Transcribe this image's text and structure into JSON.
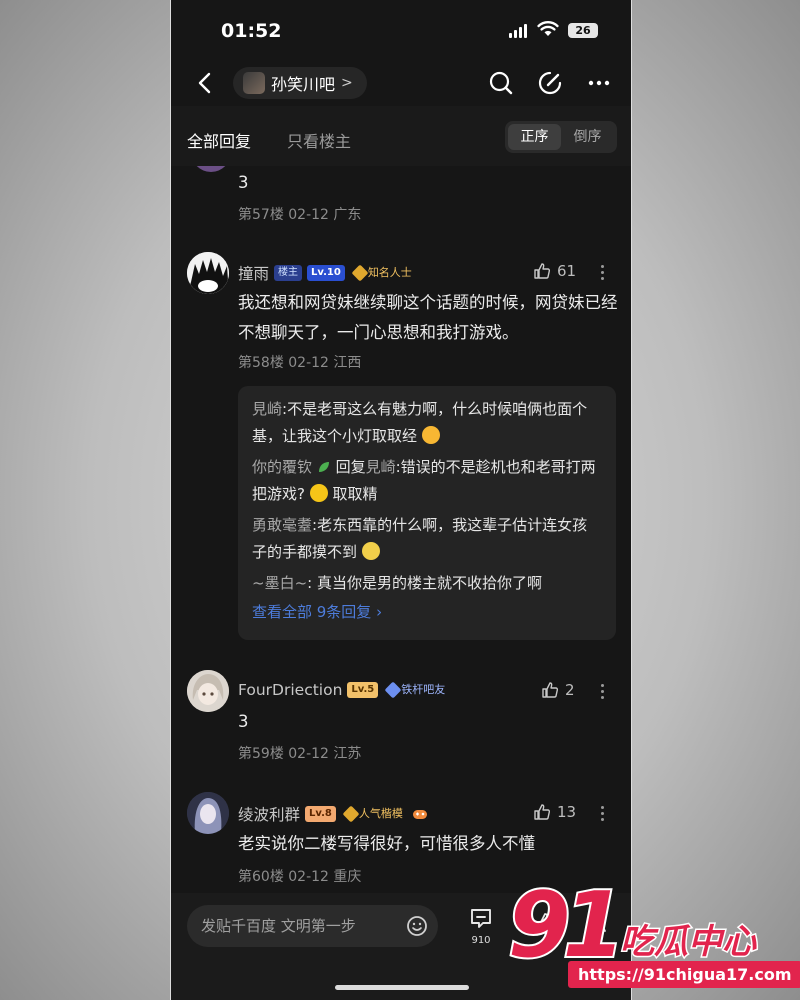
{
  "status_bar": {
    "time": "01:52",
    "battery": "26"
  },
  "nav": {
    "forum_name": "孙笑川吧",
    "chevron": ">"
  },
  "tabs": {
    "all": "全部回复",
    "host_only": "只看楼主",
    "sort_asc": "正序",
    "sort_desc": "倒序"
  },
  "posts": [
    {
      "text": "3",
      "meta": "第57楼 02-12 广东"
    },
    {
      "username": "撞雨",
      "host_badge": "楼主",
      "level": "Lv.10",
      "title": "知名人士",
      "likes": "61",
      "text": "我还想和网贷妹继续聊这个话题的时候，网贷妹已经不想聊天了，一门心思想和我打游戏。",
      "meta": "第58楼 02-12 江西",
      "replies": [
        {
          "name": "見崎",
          "text": ":不是老哥这么有魅力啊，什么时候咱俩也面个基，让我这个小灯取取经"
        },
        {
          "name": "你的覆钦",
          "reply_word": "回复",
          "target": "見崎",
          "text": ":错误的不是趁机也和老哥打两把游戏?",
          "suffix": "取取精"
        },
        {
          "name": "勇敢毫耋",
          "text": ":老东西靠的什么啊，我这辈子估计连女孩子的手都摸不到"
        },
        {
          "name": "~墨白~",
          "text": ": 真当你是男的楼主就不收拾你了啊"
        }
      ],
      "view_all": "查看全部 9条回复 ›"
    },
    {
      "username": "FourDriection",
      "level": "Lv.5",
      "title": "铁杆吧友",
      "likes": "2",
      "text": "3",
      "meta": "第59楼 02-12 江苏"
    },
    {
      "username": "绫波利群",
      "level": "Lv.8",
      "title": "人气楷模",
      "likes": "13",
      "text": "老实说你二楼写得很好，可惜很多人不懂",
      "meta": "第60楼 02-12 重庆"
    }
  ],
  "bottom_bar": {
    "placeholder": "发贴千百度 文明第一步",
    "comment_count": "910"
  },
  "watermark": {
    "number": "91",
    "brand": "吃瓜中心",
    "url": "https://91chigua17.com"
  },
  "colors": {
    "background": "#161616",
    "accent_link": "#4d7cdb",
    "watermark_red": "#e2244d",
    "gold_badge": "#f2c16a"
  },
  "icons": [
    "back-icon",
    "search-icon",
    "edit-icon",
    "more-icon",
    "like-icon",
    "emoji-icon",
    "comment-icon",
    "share-icon"
  ]
}
